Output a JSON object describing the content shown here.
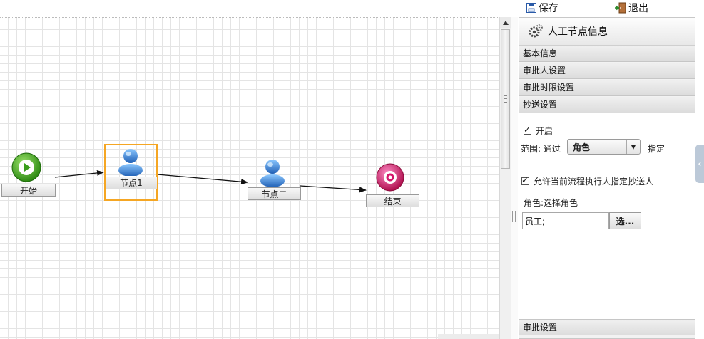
{
  "toolbar": {
    "save_label": "保存",
    "exit_label": "退出"
  },
  "flow": {
    "nodes": [
      {
        "id": "start",
        "label": "开始",
        "icon": "play-circle-icon",
        "color": "#3a9d1c"
      },
      {
        "id": "node1",
        "label": "节点1",
        "icon": "user-icon",
        "color": "#2f7ed8",
        "selected": true
      },
      {
        "id": "node2",
        "label": "节点二",
        "icon": "user-icon",
        "color": "#2f7ed8"
      },
      {
        "id": "end",
        "label": "结束",
        "icon": "target-circle-icon",
        "color": "#d4156b"
      }
    ],
    "edges": [
      {
        "from": "start",
        "to": "node1"
      },
      {
        "from": "node1",
        "to": "node2"
      },
      {
        "from": "node2",
        "to": "end"
      }
    ],
    "selection_color": "#f5a623"
  },
  "panel": {
    "title": "人工节点信息",
    "title_icon": "gears-icon",
    "sections": [
      {
        "label": "基本信息"
      },
      {
        "label": "审批人设置"
      },
      {
        "label": "审批时限设置"
      },
      {
        "label": "抄送设置",
        "expanded": true
      },
      {
        "label": "审批设置"
      }
    ],
    "cc": {
      "enable_label": "开启",
      "enable_checked": true,
      "range_label": "范围: 通过",
      "range_value": "角色",
      "range_suffix": "指定",
      "allow_label": "允许当前流程执行人指定抄送人",
      "allow_checked": true,
      "role_label": "角色:选择角色",
      "role_value": "员工;",
      "select_button": "选..."
    }
  }
}
